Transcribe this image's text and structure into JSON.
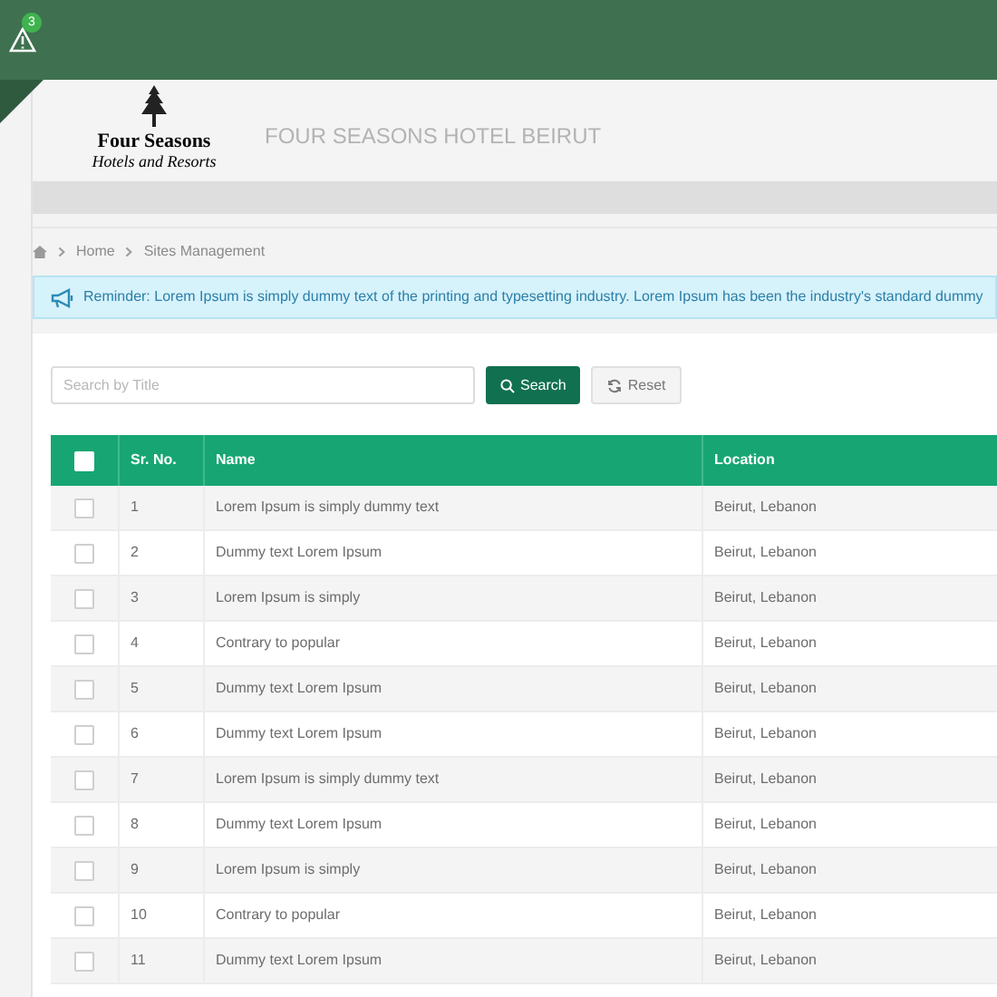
{
  "topbar": {
    "alert_count": "3"
  },
  "header": {
    "logo_name": "Four Seasons",
    "logo_tagline": "Hotels and Resorts",
    "title": "FOUR SEASONS HOTEL BEIRUT"
  },
  "breadcrumb": [
    "Home",
    "Sites Management"
  ],
  "reminder": "Reminder: Lorem Ipsum is simply dummy text of the printing and typesetting industry. Lorem Ipsum has been the industry's standard dummy",
  "search": {
    "placeholder": "Search by Title",
    "search_button": "Search",
    "reset_button": "Reset"
  },
  "table": {
    "select_all_checked": false,
    "columns": [
      "Sr. No.",
      "Name",
      "Location"
    ],
    "rows": [
      {
        "checked": false,
        "cells": [
          "1",
          "Lorem Ipsum is simply dummy text",
          "Beirut, Lebanon"
        ]
      },
      {
        "checked": false,
        "cells": [
          "2",
          "Dummy text Lorem Ipsum",
          "Beirut, Lebanon"
        ]
      },
      {
        "checked": false,
        "cells": [
          "3",
          "Lorem Ipsum is simply",
          "Beirut, Lebanon"
        ]
      },
      {
        "checked": false,
        "cells": [
          "4",
          "Contrary to popular",
          "Beirut, Lebanon"
        ]
      },
      {
        "checked": false,
        "cells": [
          "5",
          "Dummy text Lorem Ipsum",
          "Beirut, Lebanon"
        ]
      },
      {
        "checked": false,
        "cells": [
          "6",
          "Dummy text Lorem Ipsum",
          "Beirut, Lebanon"
        ]
      },
      {
        "checked": false,
        "cells": [
          "7",
          "Lorem Ipsum is simply dummy text",
          "Beirut, Lebanon"
        ]
      },
      {
        "checked": false,
        "cells": [
          "8",
          "Dummy text Lorem Ipsum",
          "Beirut, Lebanon"
        ]
      },
      {
        "checked": false,
        "cells": [
          "9",
          "Lorem Ipsum is simply",
          "Beirut, Lebanon"
        ]
      },
      {
        "checked": false,
        "cells": [
          "10",
          "Contrary to popular",
          "Beirut, Lebanon"
        ]
      },
      {
        "checked": false,
        "cells": [
          "11",
          "Dummy text Lorem Ipsum",
          "Beirut, Lebanon"
        ]
      }
    ]
  }
}
